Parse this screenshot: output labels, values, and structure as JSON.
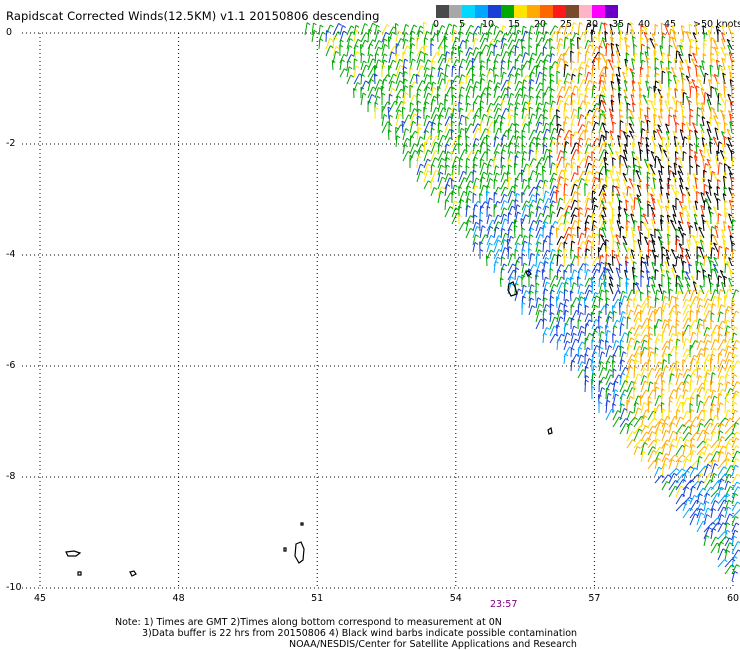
{
  "title": "Rapidscat Corrected Winds(12.5KM) v1.1 20150806 descending",
  "colorbar": {
    "colors": [
      "#4a4a4a",
      "#a8a8a8",
      "#00d8ff",
      "#00a6ff",
      "#1a3fd6",
      "#00a800",
      "#ffe400",
      "#ffaa00",
      "#ff6600",
      "#ff1a1a",
      "#7a4a2a",
      "#ffb4c8",
      "#ff00ff",
      "#6a00c8"
    ],
    "labels": [
      "0",
      "5",
      "10",
      "15",
      "20",
      "25",
      "30",
      "35",
      "40",
      "45"
    ],
    "unit": ">50 knots"
  },
  "axes": {
    "lat_ticks": [
      "0",
      "-2",
      "-4",
      "-6",
      "-8",
      "-10"
    ],
    "lon_ticks": [
      "45",
      "48",
      "51",
      "54",
      "57",
      "60"
    ],
    "lat_range": [
      -10,
      0
    ],
    "lon_range": [
      45,
      60
    ]
  },
  "time_label": "23:57",
  "notes": [
    "Note: 1) Times are GMT 2)Times along bottom correspond to measurement at 0N",
    "3)Data buffer is 22 hrs from 20150806 4) Black wind barbs indicate possible contamination",
    "NOAA/NESDIS/Center for Satellite Applications and Research"
  ],
  "map_data": {
    "swath_edge": [
      [
        50.6,
        0
      ],
      [
        60,
        -10
      ]
    ],
    "wind_speed_knots": [
      {
        "region": "north-west swath",
        "range": [
          15,
          20
        ],
        "color": "#00a800"
      },
      {
        "region": "central swath",
        "range": [
          10,
          20
        ],
        "color": "#1a3fd6"
      },
      {
        "region": "north-east swath",
        "range": [
          20,
          35
        ],
        "color": "#ffaa00"
      },
      {
        "region": "south-east swath",
        "range": [
          10,
          20
        ],
        "color": "#00a6ff"
      }
    ]
  }
}
